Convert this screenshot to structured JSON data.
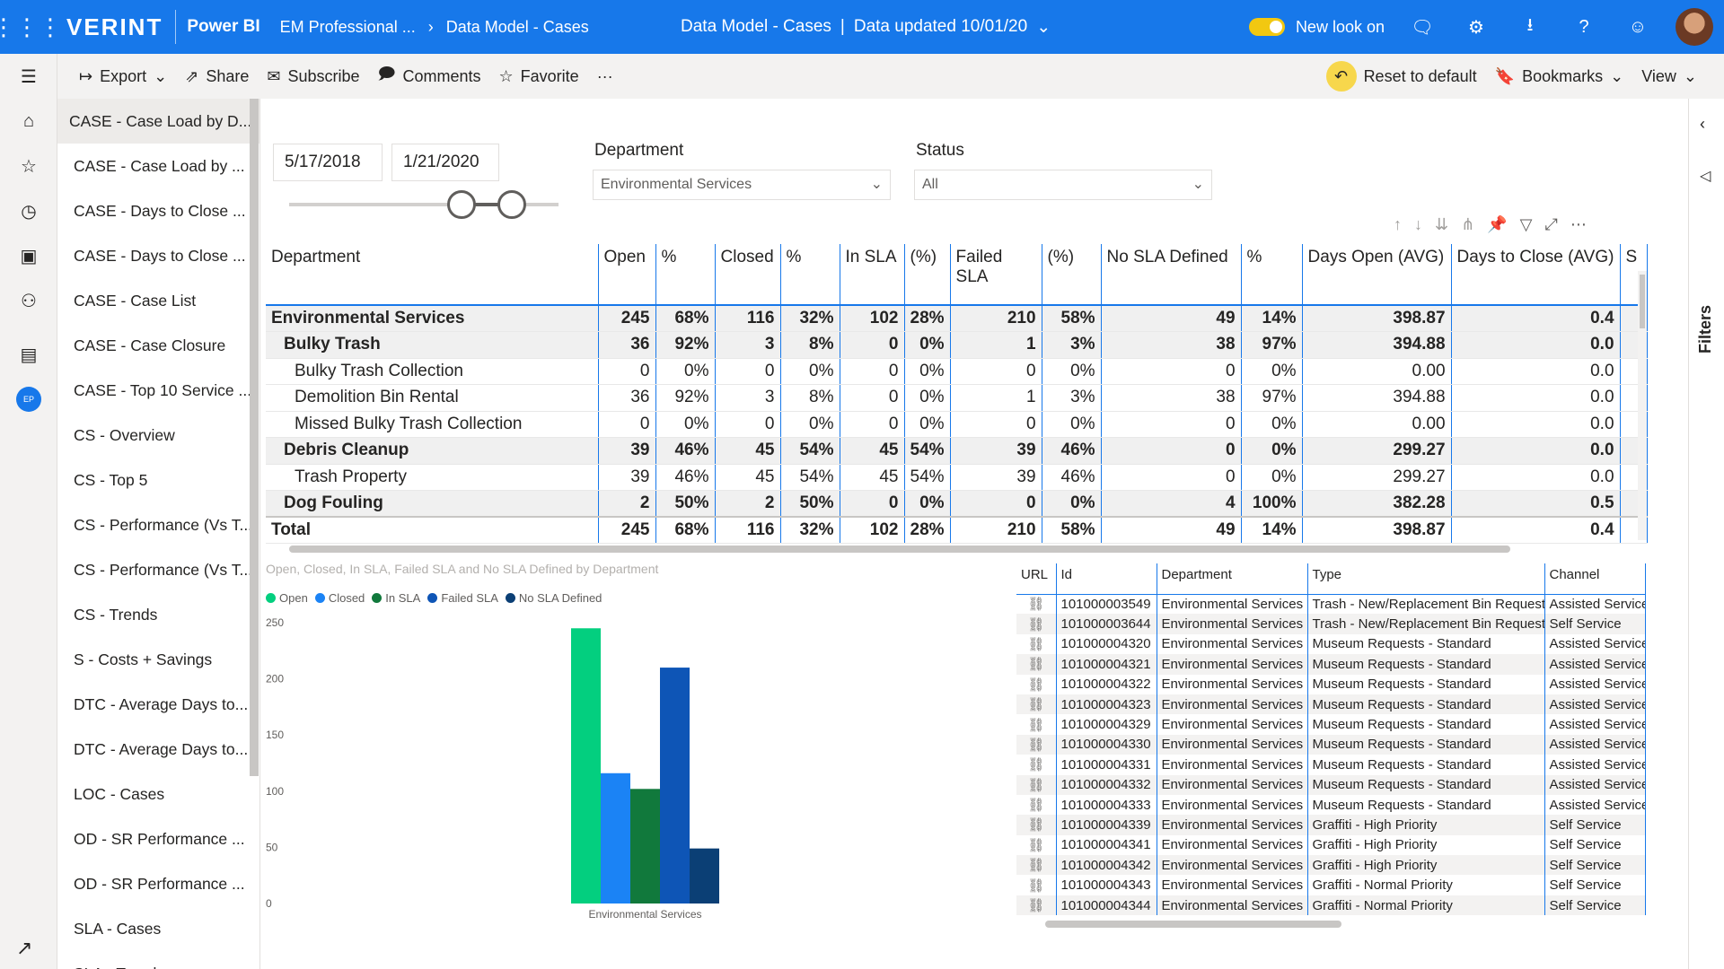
{
  "header": {
    "brand": "VERINT",
    "product": "Power BI",
    "workspace": "EM Professional ...",
    "report": "Data Model - Cases",
    "center_title": "Data Model - Cases",
    "separator": "|",
    "data_updated": "Data updated 10/01/20",
    "new_look_label": "New look on"
  },
  "toolbar": {
    "export": "Export",
    "share": "Share",
    "subscribe": "Subscribe",
    "comments": "Comments",
    "favorite": "Favorite",
    "more": "···",
    "reset": "Reset to default",
    "bookmarks": "Bookmarks",
    "view": "View"
  },
  "rail": {
    "user_initials": "EP"
  },
  "pages": [
    "CASE - Case Load by D...",
    "CASE - Case Load by ...",
    "CASE - Days to Close ...",
    "CASE - Days to Close ...",
    "CASE - Case List",
    "CASE - Case Closure",
    "CASE - Top 10 Service ...",
    "CS - Overview",
    "CS - Top 5",
    "CS - Performance (Vs T...",
    "CS - Performance (Vs T...",
    "CS - Trends",
    "S - Costs + Savings",
    "DTC - Average Days to...",
    "DTC - Average Days to...",
    "LOC - Cases",
    "OD - SR Performance ...",
    "OD - SR Performance ...",
    "SLA - Cases",
    "SLA - Trend"
  ],
  "filters_panel": {
    "label": "Filters"
  },
  "date_slicer": {
    "start": "5/17/2018",
    "end": "1/21/2020"
  },
  "department_filter": {
    "label": "Department",
    "value": "Environmental Services"
  },
  "status_filter": {
    "label": "Status",
    "value": "All"
  },
  "matrix": {
    "headers": [
      "Department",
      "Open",
      "%",
      "Closed",
      "%",
      "In SLA",
      "(%)",
      "Failed SLA",
      "(%)",
      "No SLA Defined",
      "%",
      "Days Open (AVG)",
      "Days to Close (AVG)",
      "S"
    ],
    "rows": [
      {
        "level": "l0",
        "cells": [
          "Environmental Services",
          "245",
          "68%",
          "116",
          "32%",
          "102",
          "28%",
          "210",
          "58%",
          "49",
          "14%",
          "398.87",
          "0.4",
          ""
        ]
      },
      {
        "level": "l1",
        "cells": [
          "Bulky Trash",
          "36",
          "92%",
          "3",
          "8%",
          "0",
          "0%",
          "1",
          "3%",
          "38",
          "97%",
          "394.88",
          "0.0",
          ""
        ]
      },
      {
        "level": "l2",
        "cells": [
          "Bulky Trash Collection",
          "0",
          "0%",
          "0",
          "0%",
          "0",
          "0%",
          "0",
          "0%",
          "0",
          "0%",
          "0.00",
          "0.0",
          ""
        ]
      },
      {
        "level": "l2",
        "cells": [
          "Demolition Bin Rental",
          "36",
          "92%",
          "3",
          "8%",
          "0",
          "0%",
          "1",
          "3%",
          "38",
          "97%",
          "394.88",
          "0.0",
          ""
        ]
      },
      {
        "level": "l2",
        "cells": [
          "Missed Bulky Trash Collection",
          "0",
          "0%",
          "0",
          "0%",
          "0",
          "0%",
          "0",
          "0%",
          "0",
          "0%",
          "0.00",
          "0.0",
          ""
        ]
      },
      {
        "level": "l1",
        "cells": [
          "Debris Cleanup",
          "39",
          "46%",
          "45",
          "54%",
          "45",
          "54%",
          "39",
          "46%",
          "0",
          "0%",
          "299.27",
          "0.0",
          ""
        ]
      },
      {
        "level": "l2",
        "cells": [
          "Trash Property",
          "39",
          "46%",
          "45",
          "54%",
          "45",
          "54%",
          "39",
          "46%",
          "0",
          "0%",
          "299.27",
          "0.0",
          ""
        ]
      },
      {
        "level": "l1",
        "cells": [
          "Dog Fouling",
          "2",
          "50%",
          "2",
          "50%",
          "0",
          "0%",
          "0",
          "0%",
          "4",
          "100%",
          "382.28",
          "0.5",
          ""
        ]
      },
      {
        "level": "tot",
        "cells": [
          "Total",
          "245",
          "68%",
          "116",
          "32%",
          "102",
          "28%",
          "210",
          "58%",
          "49",
          "14%",
          "398.87",
          "0.4",
          ""
        ]
      }
    ]
  },
  "chart_data": {
    "type": "bar",
    "title": "Open, Closed, In SLA, Failed SLA and No SLA Defined by Department",
    "categories": [
      "Environmental Services"
    ],
    "series": [
      {
        "name": "Open",
        "values": [
          245
        ],
        "color": "#03cf7f"
      },
      {
        "name": "Closed",
        "values": [
          116
        ],
        "color": "#1b83f5"
      },
      {
        "name": "In SLA",
        "values": [
          102
        ],
        "color": "#11793c"
      },
      {
        "name": "Failed SLA",
        "values": [
          210
        ],
        "color": "#0e55b6"
      },
      {
        "name": "No SLA Defined",
        "values": [
          49
        ],
        "color": "#0b3f75"
      }
    ],
    "yticks": [
      "0",
      "50",
      "100",
      "150",
      "200",
      "250"
    ],
    "ylim": [
      0,
      250
    ],
    "grid": false,
    "legend_position": "top-left"
  },
  "case_table": {
    "headers": [
      "URL",
      "Id",
      "Department",
      "Type",
      "Channel"
    ],
    "rows": [
      [
        "101000003549",
        "Environmental Services",
        "Trash - New/Replacement Bin Request",
        "Assisted Service"
      ],
      [
        "101000003644",
        "Environmental Services",
        "Trash - New/Replacement Bin Request",
        "Self Service"
      ],
      [
        "101000004320",
        "Environmental Services",
        "Museum Requests - Standard",
        "Assisted Service"
      ],
      [
        "101000004321",
        "Environmental Services",
        "Museum Requests - Standard",
        "Assisted Service"
      ],
      [
        "101000004322",
        "Environmental Services",
        "Museum Requests - Standard",
        "Assisted Service"
      ],
      [
        "101000004323",
        "Environmental Services",
        "Museum Requests - Standard",
        "Assisted Service"
      ],
      [
        "101000004329",
        "Environmental Services",
        "Museum Requests - Standard",
        "Assisted Service"
      ],
      [
        "101000004330",
        "Environmental Services",
        "Museum Requests - Standard",
        "Assisted Service"
      ],
      [
        "101000004331",
        "Environmental Services",
        "Museum Requests - Standard",
        "Assisted Service"
      ],
      [
        "101000004332",
        "Environmental Services",
        "Museum Requests - Standard",
        "Assisted Service"
      ],
      [
        "101000004333",
        "Environmental Services",
        "Museum Requests - Standard",
        "Assisted Service"
      ],
      [
        "101000004339",
        "Environmental Services",
        "Graffiti - High Priority",
        "Self Service"
      ],
      [
        "101000004341",
        "Environmental Services",
        "Graffiti - High Priority",
        "Self Service"
      ],
      [
        "101000004342",
        "Environmental Services",
        "Graffiti - High Priority",
        "Self Service"
      ],
      [
        "101000004343",
        "Environmental Services",
        "Graffiti - Normal Priority",
        "Self Service"
      ],
      [
        "101000004344",
        "Environmental Services",
        "Graffiti - Normal Priority",
        "Self Service"
      ]
    ]
  },
  "icons": {
    "waffle": "app-launcher-icon",
    "link": "link-icon"
  }
}
